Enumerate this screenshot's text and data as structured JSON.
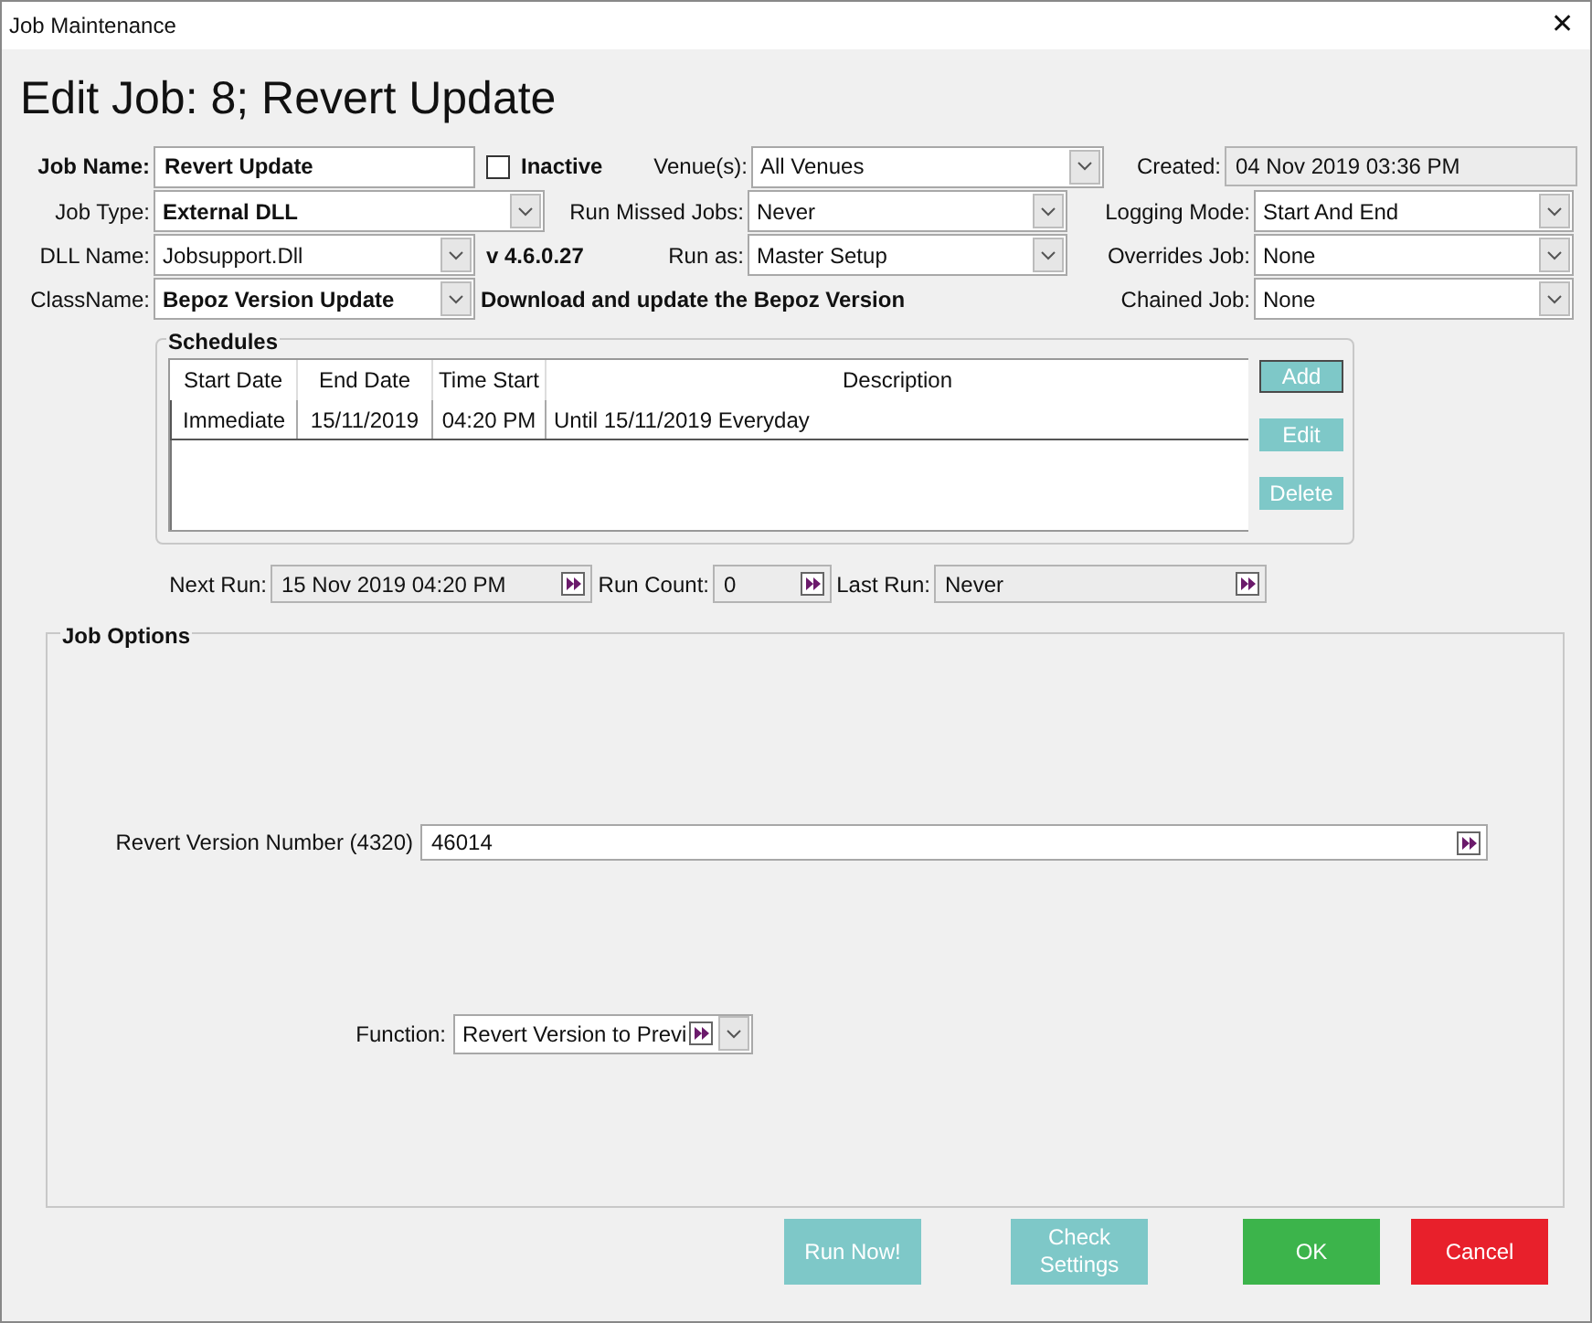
{
  "window": {
    "title": "Job Maintenance",
    "close": "✕"
  },
  "heading": "Edit Job: 8; Revert Update",
  "job_name": {
    "label": "Job Name:",
    "value": "Revert Update"
  },
  "inactive": {
    "label": "Inactive",
    "checked": false
  },
  "venues": {
    "label": "Venue(s):",
    "value": "All Venues"
  },
  "created": {
    "label": "Created:",
    "value": "04 Nov 2019 03:36 PM"
  },
  "job_type": {
    "label": "Job Type:",
    "value": "External DLL"
  },
  "run_missed_jobs": {
    "label": "Run Missed Jobs:",
    "value": "Never"
  },
  "logging_mode": {
    "label": "Logging Mode:",
    "value": "Start And End"
  },
  "dll_name": {
    "label": "DLL Name:",
    "value": "Jobsupport.Dll"
  },
  "version": "v 4.6.0.27",
  "run_as": {
    "label": "Run as:",
    "value": "Master Setup"
  },
  "overrides_job": {
    "label": "Overrides Job:",
    "value": "None"
  },
  "class_name": {
    "label": "ClassName:",
    "value": "Bepoz Version Update"
  },
  "class_description": "Download and update the Bepoz Version",
  "chained_job": {
    "label": "Chained Job:",
    "value": "None"
  },
  "schedules": {
    "title": "Schedules",
    "columns": [
      "Start Date",
      "End Date",
      "Time Start",
      "Description"
    ],
    "rows": [
      [
        "Immediate",
        "15/11/2019",
        "04:20 PM",
        "Until 15/11/2019 Everyday"
      ]
    ],
    "buttons": [
      {
        "label": "Add",
        "focused": true
      },
      {
        "label": "Edit",
        "focused": false
      },
      {
        "label": "Delete",
        "focused": false
      }
    ]
  },
  "next_run": {
    "label": "Next Run:",
    "value": "15 Nov 2019 04:20 PM"
  },
  "run_count": {
    "label": "Run Count:",
    "value": "0"
  },
  "last_run": {
    "label": "Last Run:",
    "value": "Never"
  },
  "job_options": {
    "title": "Job Options",
    "revert_version": {
      "label": "Revert Version Number (4320)",
      "value": "46014"
    },
    "function": {
      "label": "Function:",
      "value": "Revert Version to Previ"
    }
  },
  "buttons": [
    {
      "label": "Run Now!",
      "kind": "secondary"
    },
    {
      "label": "Check Settings",
      "kind": "secondary"
    },
    {
      "label": "OK",
      "kind": "ok"
    },
    {
      "label": "Cancel",
      "kind": "cancel"
    }
  ]
}
